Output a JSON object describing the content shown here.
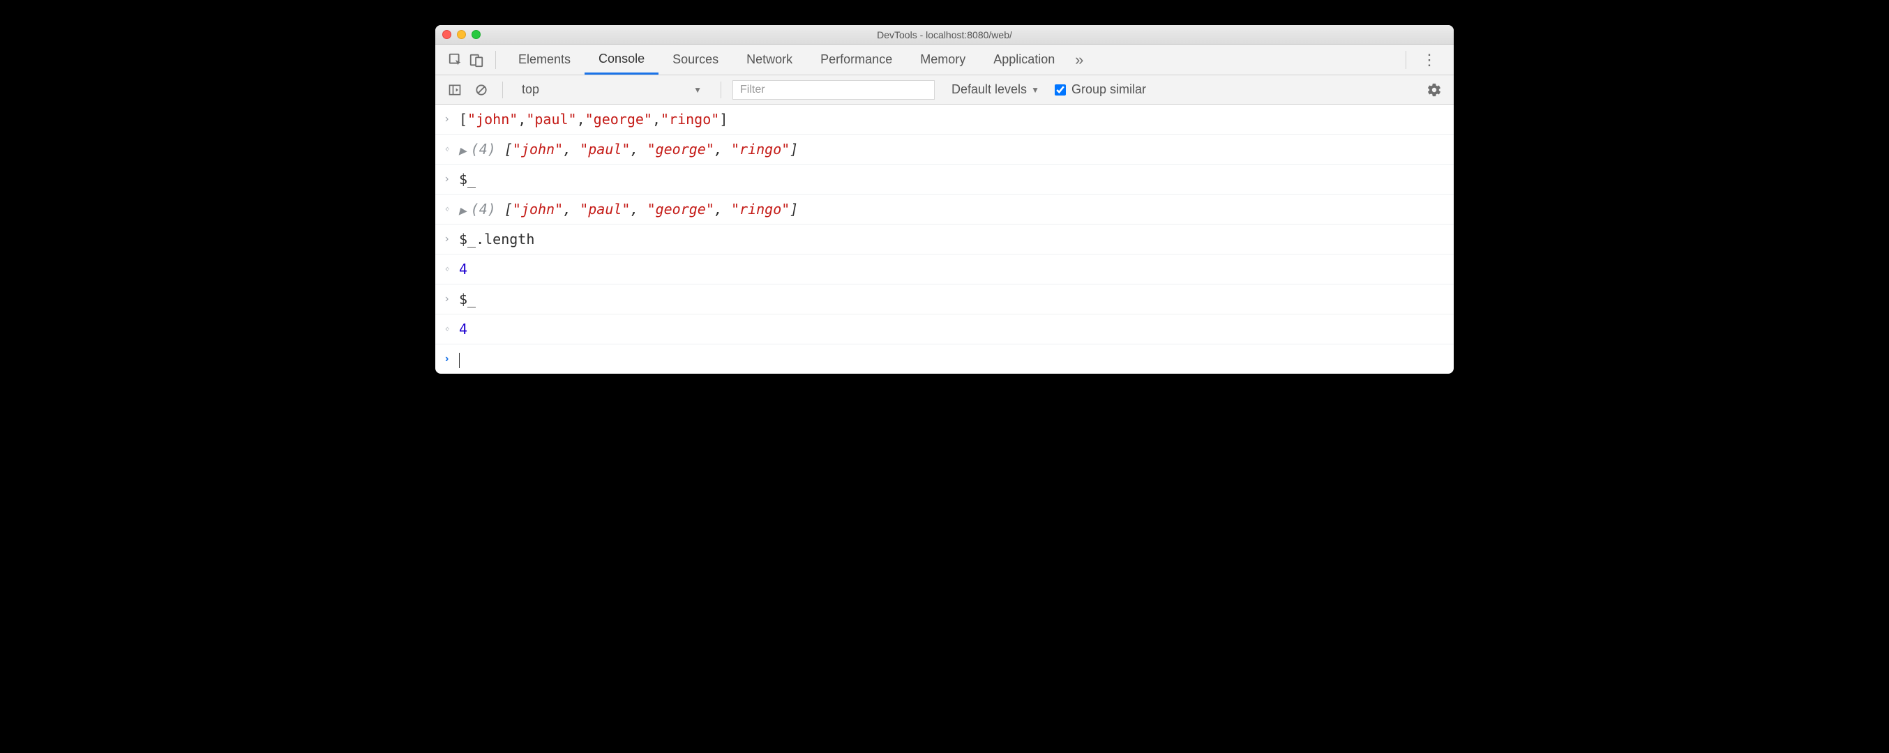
{
  "title": "DevTools - localhost:8080/web/",
  "tabs": [
    "Elements",
    "Console",
    "Sources",
    "Network",
    "Performance",
    "Memory",
    "Application"
  ],
  "active_tab_index": 1,
  "toolbar": {
    "context": "top",
    "filter_placeholder": "Filter",
    "levels_label": "Default levels",
    "group_similar_label": "Group similar",
    "group_similar_checked": true
  },
  "console": {
    "lines": [
      {
        "kind": "input",
        "segments": [
          {
            "t": "plain",
            "v": "["
          },
          {
            "t": "str",
            "v": "\"john\""
          },
          {
            "t": "plain",
            "v": ","
          },
          {
            "t": "str",
            "v": "\"paul\""
          },
          {
            "t": "plain",
            "v": ","
          },
          {
            "t": "str",
            "v": "\"george\""
          },
          {
            "t": "plain",
            "v": ","
          },
          {
            "t": "str",
            "v": "\"ringo\""
          },
          {
            "t": "plain",
            "v": "]"
          }
        ]
      },
      {
        "kind": "output",
        "expandable": true,
        "italic": true,
        "segments": [
          {
            "t": "dim",
            "v": "(4) "
          },
          {
            "t": "plain",
            "v": "["
          },
          {
            "t": "str",
            "v": "\"john\""
          },
          {
            "t": "plain",
            "v": ", "
          },
          {
            "t": "str",
            "v": "\"paul\""
          },
          {
            "t": "plain",
            "v": ", "
          },
          {
            "t": "str",
            "v": "\"george\""
          },
          {
            "t": "plain",
            "v": ", "
          },
          {
            "t": "str",
            "v": "\"ringo\""
          },
          {
            "t": "plain",
            "v": "]"
          }
        ]
      },
      {
        "kind": "input",
        "segments": [
          {
            "t": "plain",
            "v": "$_"
          }
        ]
      },
      {
        "kind": "output",
        "expandable": true,
        "italic": true,
        "segments": [
          {
            "t": "dim",
            "v": "(4) "
          },
          {
            "t": "plain",
            "v": "["
          },
          {
            "t": "str",
            "v": "\"john\""
          },
          {
            "t": "plain",
            "v": ", "
          },
          {
            "t": "str",
            "v": "\"paul\""
          },
          {
            "t": "plain",
            "v": ", "
          },
          {
            "t": "str",
            "v": "\"george\""
          },
          {
            "t": "plain",
            "v": ", "
          },
          {
            "t": "str",
            "v": "\"ringo\""
          },
          {
            "t": "plain",
            "v": "]"
          }
        ]
      },
      {
        "kind": "input",
        "segments": [
          {
            "t": "plain",
            "v": "$_.length"
          }
        ]
      },
      {
        "kind": "output",
        "segments": [
          {
            "t": "num",
            "v": "4"
          }
        ]
      },
      {
        "kind": "input",
        "segments": [
          {
            "t": "plain",
            "v": "$_"
          }
        ]
      },
      {
        "kind": "output",
        "segments": [
          {
            "t": "num",
            "v": "4"
          }
        ]
      }
    ]
  }
}
